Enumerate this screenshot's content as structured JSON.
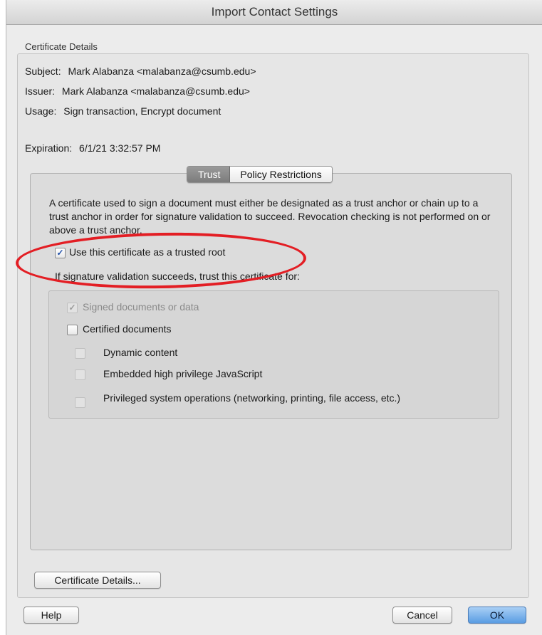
{
  "window": {
    "title": "Import Contact Settings"
  },
  "certificate": {
    "section_label": "Certificate Details",
    "subject_label": "Subject:",
    "subject_value": "Mark Alabanza <malabanza@csumb.edu>",
    "issuer_label": "Issuer:",
    "issuer_value": "Mark Alabanza <malabanza@csumb.edu>",
    "usage_label": "Usage:",
    "usage_value": "Sign transaction, Encrypt document",
    "expiration_label": "Expiration:",
    "expiration_value": "6/1/21 3:32:57 PM"
  },
  "tabs": [
    {
      "label": "Trust",
      "active": true
    },
    {
      "label": "Policy Restrictions",
      "active": false
    }
  ],
  "trust": {
    "description": "A certificate used to sign a document must either be designated as a trust anchor or chain up to a trust anchor in order for signature validation to succeed.  Revocation checking is not performed on or above a trust anchor.",
    "trusted_root_label": "Use this certificate as a trusted root",
    "trusted_root_checked": true,
    "trust_for_label": "If signature validation succeeds, trust this certificate for:",
    "options": {
      "signed_docs": {
        "label": "Signed documents or data",
        "checked": true,
        "disabled": true
      },
      "certified_docs": {
        "label": "Certified documents",
        "checked": false
      },
      "dynamic_content": {
        "label": "Dynamic content",
        "checked": false,
        "disabled": true
      },
      "embedded_js": {
        "label": "Embedded high privilege JavaScript",
        "checked": false,
        "disabled": true
      },
      "privileged_ops": {
        "label": "Privileged system operations (networking, printing, file access, etc.)",
        "checked": false,
        "disabled": true
      }
    }
  },
  "buttons": {
    "certificate_details": "Certificate Details...",
    "help": "Help",
    "cancel": "Cancel",
    "ok": "OK"
  },
  "colors": {
    "annotation": "#e31e24",
    "primary_button": "#5a9de3"
  }
}
